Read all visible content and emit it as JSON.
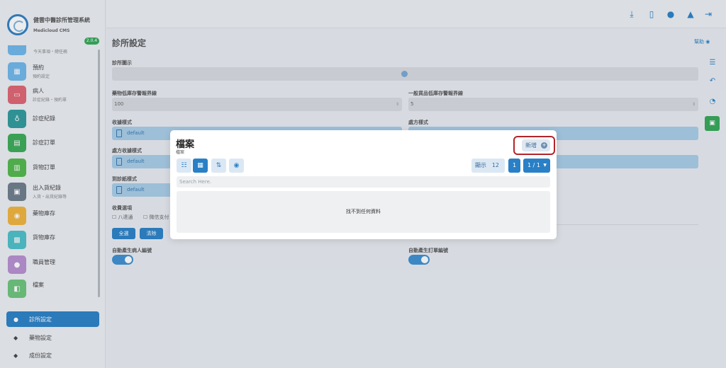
{
  "app": {
    "title": "健雲中醫診所管理系統",
    "subtitle": "Medicloud CMS",
    "version": "2.0.4"
  },
  "sidebar": {
    "cut_item_text": "今天事項・總任務",
    "items": [
      {
        "label": "預約",
        "sub": "預約設定",
        "color": "#6fb7ea",
        "icon": "calendar-icon"
      },
      {
        "label": "病人",
        "sub": "診症紀錄・預約單",
        "color": "#e06470",
        "icon": "id-card-icon"
      },
      {
        "label": "診症紀錄",
        "sub": "",
        "color": "#2e9a9a",
        "icon": "stethoscope-icon"
      },
      {
        "label": "診症訂單",
        "sub": "",
        "color": "#3aab55",
        "icon": "clipboard-icon"
      },
      {
        "label": "貨物訂單",
        "sub": "",
        "color": "#52b84a",
        "icon": "document-icon"
      },
      {
        "label": "出入貨紀錄",
        "sub": "入貨・出貨紀錄等",
        "color": "#6f7c8a",
        "icon": "truck-icon"
      },
      {
        "label": "藥物庫存",
        "sub": "",
        "color": "#f2b43a",
        "icon": "pills-icon"
      },
      {
        "label": "貨物庫存",
        "sub": "",
        "color": "#4cc0c8",
        "icon": "boxes-icon"
      },
      {
        "label": "職員管理",
        "sub": "",
        "color": "#b88fd0",
        "icon": "user-icon"
      },
      {
        "label": "檔案",
        "sub": "",
        "color": "#6cc47a",
        "icon": "file-icon"
      }
    ],
    "bottom_items": [
      {
        "label": "診所設定",
        "active": true,
        "icon": "clinic-settings-icon"
      },
      {
        "label": "藥物設定",
        "active": false,
        "icon": "medicine-settings-icon"
      },
      {
        "label": "成份設定",
        "active": false,
        "icon": "ingredient-settings-icon"
      }
    ]
  },
  "header": {
    "icons": [
      "download-icon",
      "clipboard-icon",
      "user-icon",
      "bell-icon",
      "logout-icon"
    ]
  },
  "main": {
    "title": "診所設定",
    "help": "幫助",
    "clinic_icon_label": "診所圖示",
    "medicine_stock_label": "藥物低庫存警報界線",
    "medicine_stock_value": "100",
    "goods_stock_label": "一般貨品低庫存警報界線",
    "goods_stock_value": "5",
    "receipt_label": "收據樣式",
    "receipt_value": "default",
    "prescription_label": "處方樣式",
    "prescription_receipt_label": "處方收據樣式",
    "prescription_receipt_value": "default",
    "referral_label": "到診紙樣式",
    "referral_value": "default",
    "payment_label": "收費選項",
    "payment_options": [
      "八達通",
      "微信支付"
    ],
    "select_all": "全選",
    "clear": "清除",
    "auto_patient_label": "自動產生病人編號",
    "auto_order_label": "自動產生訂單編號"
  },
  "modal": {
    "title": "檔案",
    "subtitle": "檔案",
    "new_label": "新增",
    "show_label": "顯示",
    "show_count": "12",
    "page": "1",
    "page_select": "1 / 1",
    "search_placeholder": "Search Here.",
    "empty_text": "找不到任何資料"
  }
}
